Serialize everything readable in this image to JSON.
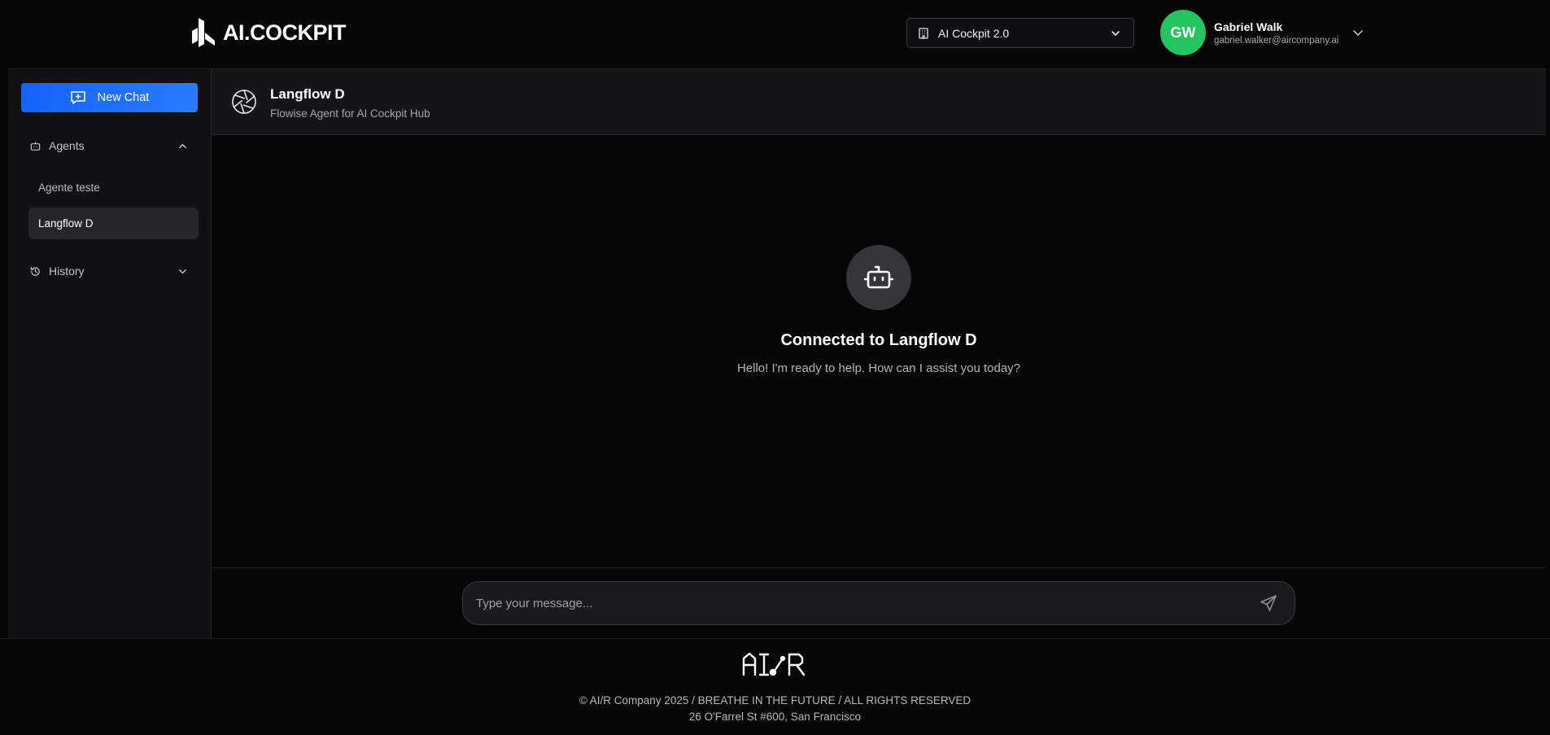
{
  "brand": {
    "logo_text": "AI.COCKPIT",
    "logo_icon": "ai-cockpit-logo"
  },
  "workspace": {
    "selected": "AI Cockpit 2.0",
    "icon": "building-icon"
  },
  "user": {
    "initials": "GW",
    "name": "Gabriel Walk",
    "email": "gabriel.walker@aircompany.ai",
    "avatar_color": "#22c55e"
  },
  "sidebar": {
    "new_chat_label": "New Chat",
    "agents_label": "Agents",
    "agents_expanded": true,
    "agents": [
      {
        "label": "Agente teste",
        "active": false
      },
      {
        "label": "Langflow D",
        "active": true
      }
    ],
    "history_label": "History",
    "history_expanded": false
  },
  "chat": {
    "agent_name": "Langflow D",
    "agent_description": "Flowise Agent for AI Cockpit Hub",
    "empty_title": "Connected to Langflow D",
    "empty_message": "Hello! I'm ready to help. How can I assist you today?",
    "input_placeholder": "Type your message...",
    "input_value": ""
  },
  "footer": {
    "logo_text": "AI/R",
    "copyright": "© AI/R Company 2025 / BREATHE IN THE FUTURE / ALL RIGHTS RESERVED",
    "address": "26 O'Farrel St #600, San Francisco"
  },
  "colors": {
    "accent": "#1463ff",
    "background": "#060607",
    "panel": "#111113",
    "avatar": "#22c55e"
  }
}
